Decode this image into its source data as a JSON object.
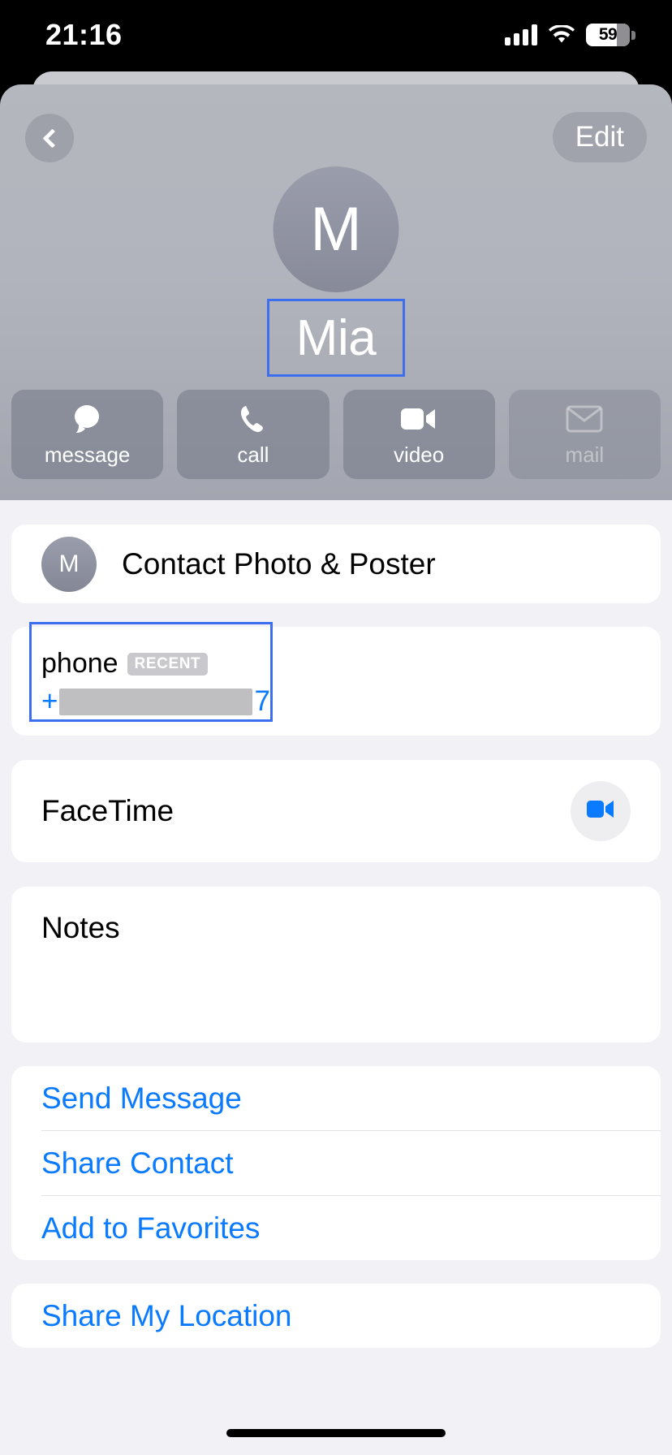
{
  "status_bar": {
    "time": "21:16",
    "battery_percent": "59",
    "signal_icon": "cellular-bars-icon",
    "wifi_icon": "wifi-icon",
    "battery_icon": "battery-icon"
  },
  "header": {
    "back_icon": "chevron-left-icon",
    "edit_label": "Edit",
    "avatar_initial": "M",
    "contact_name": "Mia",
    "actions": [
      {
        "label": "message",
        "icon": "message-bubble-icon",
        "disabled": false
      },
      {
        "label": "call",
        "icon": "phone-icon",
        "disabled": false
      },
      {
        "label": "video",
        "icon": "video-camera-icon",
        "disabled": false
      },
      {
        "label": "mail",
        "icon": "envelope-icon",
        "disabled": true
      }
    ]
  },
  "content": {
    "photo_poster": {
      "avatar_initial": "M",
      "title": "Contact Photo & Poster"
    },
    "phone": {
      "label": "phone",
      "badge": "RECENT",
      "prefix": "+",
      "suffix": "7"
    },
    "facetime": {
      "label": "FaceTime",
      "button_icon": "video-camera-icon"
    },
    "notes": {
      "title": "Notes",
      "value": ""
    },
    "links": [
      {
        "label": "Send Message"
      },
      {
        "label": "Share Contact"
      },
      {
        "label": "Add to Favorites"
      }
    ],
    "links_secondary": [
      {
        "label": "Share My Location"
      }
    ]
  },
  "colors": {
    "accent_blue": "#0a7aff",
    "selection_blue": "#3d6ef0",
    "page_background": "#f2f2f6",
    "card_background": "#ffffff"
  }
}
